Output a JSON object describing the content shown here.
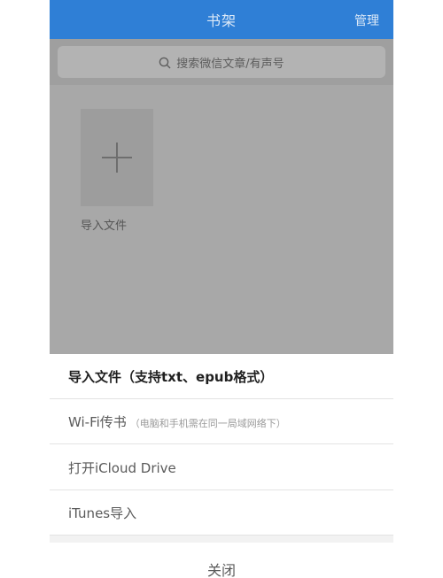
{
  "header": {
    "title": "书架",
    "manage_label": "管理"
  },
  "search": {
    "placeholder": "搜索微信文章/有声号",
    "icon": "search-icon"
  },
  "shelf": {
    "import_tile_label": "导入文件",
    "import_tile_icon": "plus-icon"
  },
  "action_sheet": {
    "items": [
      {
        "label": "导入文件（支持txt、epub格式）",
        "note": ""
      },
      {
        "label": "Wi-Fi传书",
        "note": "（电脑和手机需在同一局域网络下）"
      },
      {
        "label": "打开iCloud Drive",
        "note": ""
      },
      {
        "label": "iTunes导入",
        "note": ""
      }
    ],
    "close_label": "关闭"
  },
  "colors": {
    "header_bg": "#2f7fd6",
    "overlay": "#a8a8a8",
    "sheet_bg": "#ffffff"
  }
}
